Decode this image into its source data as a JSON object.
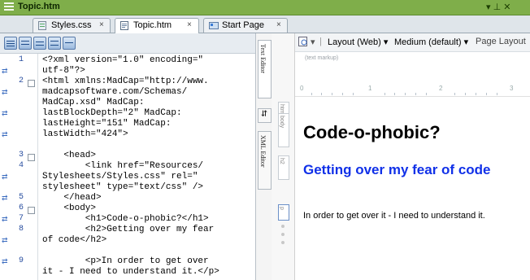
{
  "window": {
    "title": "Topic.htm",
    "controls": "▾ ⊥ ✕"
  },
  "tabs": [
    {
      "label": "Styles.css",
      "close": "×"
    },
    {
      "label": "Topic.htm",
      "close": "×"
    },
    {
      "label": "Start Page",
      "close": "×"
    }
  ],
  "side_tabs": {
    "text_editor": "Text Editor",
    "xml_editor": "XML Editor"
  },
  "side_labels": {
    "html": "html",
    "body": "body",
    "h2": "h2",
    "p": "p"
  },
  "editor": {
    "line_numbers": [
      "1",
      "2",
      "3",
      "4",
      "5",
      "6",
      "7",
      "8",
      "9"
    ],
    "lines": [
      "<?xml version=\"1.0\" encoding=\"",
      "utf-8\"?>",
      "<html xmlns:MadCap=\"http://www.",
      "madcapsoftware.com/Schemas/",
      "MadCap.xsd\" MadCap:",
      "lastBlockDepth=\"2\" MadCap:",
      "lastHeight=\"151\" MadCap:",
      "lastWidth=\"424\">",
      "    <head>",
      "        <link href=\"Resources/",
      "Stylesheets/Styles.css\" rel=\"",
      "stylesheet\" type=\"text/css\" />",
      "    </head>",
      "    <body>",
      "        <h1>Code-o-phobic?</h1>",
      "        <h2>Getting over my fear",
      "of code</h2>",
      "        <p>In order to get over",
      "it - I need to understand it.</p>"
    ]
  },
  "preview_toolbar": {
    "layout": "Layout (Web)",
    "medium": "Medium (default)",
    "page_layout": "Page Layout"
  },
  "preview": {
    "markup_hint": "(text markup)",
    "ruler_marks": [
      "0",
      "1",
      "2",
      "3"
    ],
    "h1": "Code-o-phobic?",
    "h2": "Getting over my fear of code",
    "p": "In order to get over it - I need to understand it."
  }
}
